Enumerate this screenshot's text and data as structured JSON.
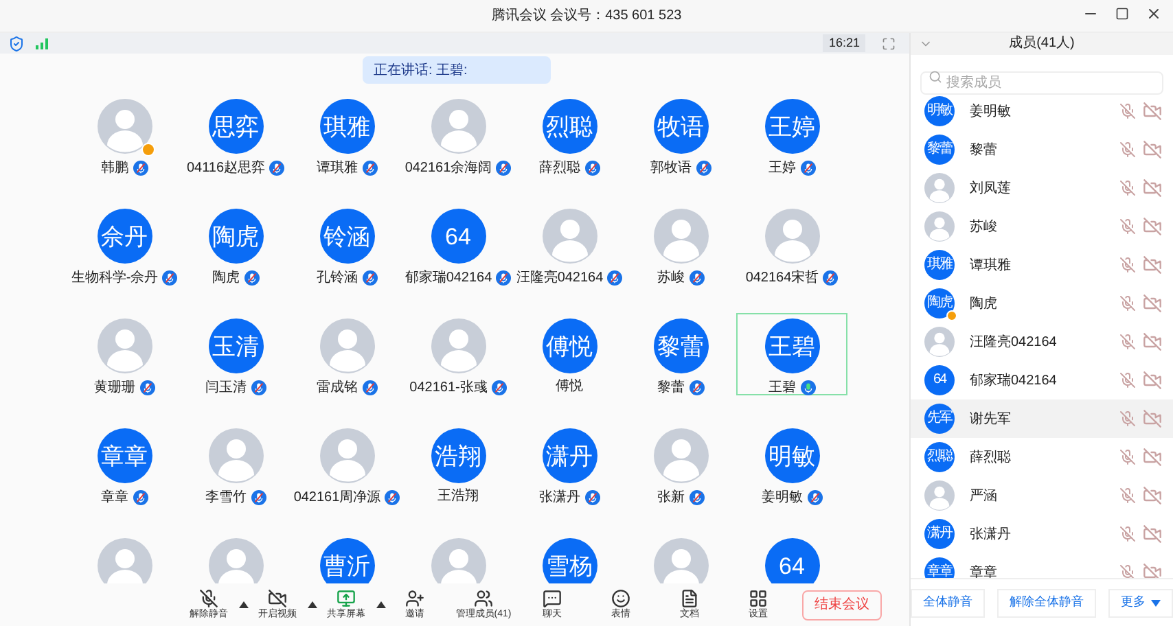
{
  "window": {
    "title": "腾讯会议 会议号：435 601 523"
  },
  "status_strip": {
    "time": "16:21"
  },
  "speaking_banner": "正在讲话: 王碧:",
  "participants": [
    {
      "name": "韩鹏",
      "kind": "photo",
      "host": true,
      "muted": true,
      "speaking": false,
      "selected": false
    },
    {
      "name": "04116赵思弈",
      "kind": "initials",
      "initials": "思弈",
      "host": false,
      "muted": true,
      "speaking": false,
      "selected": false
    },
    {
      "name": "谭琪雅",
      "kind": "initials",
      "initials": "琪雅",
      "host": false,
      "muted": true,
      "speaking": false,
      "selected": false
    },
    {
      "name": "042161余海阔",
      "kind": "photo",
      "host": false,
      "muted": true,
      "speaking": false,
      "selected": false
    },
    {
      "name": "薛烈聪",
      "kind": "initials",
      "initials": "烈聪",
      "host": false,
      "muted": true,
      "speaking": false,
      "selected": false
    },
    {
      "name": "郭牧语",
      "kind": "initials",
      "initials": "牧语",
      "host": false,
      "muted": true,
      "speaking": false,
      "selected": false
    },
    {
      "name": "王婷",
      "kind": "initials",
      "initials": "王婷",
      "host": false,
      "muted": true,
      "speaking": false,
      "selected": false
    },
    {
      "name": "生物科学-佘丹",
      "kind": "initials",
      "initials": "佘丹",
      "host": false,
      "muted": true,
      "speaking": false,
      "selected": false
    },
    {
      "name": "陶虎",
      "kind": "initials",
      "initials": "陶虎",
      "host": false,
      "muted": true,
      "speaking": false,
      "selected": false
    },
    {
      "name": "孔铃涵",
      "kind": "initials",
      "initials": "铃涵",
      "host": false,
      "muted": true,
      "speaking": false,
      "selected": false
    },
    {
      "name": "郁家瑞042164",
      "kind": "initials",
      "initials": "64",
      "host": false,
      "muted": true,
      "speaking": false,
      "selected": false
    },
    {
      "name": "汪隆亮042164",
      "kind": "photo",
      "host": false,
      "muted": true,
      "speaking": false,
      "selected": false
    },
    {
      "name": "苏峻",
      "kind": "photo",
      "host": false,
      "muted": true,
      "speaking": false,
      "selected": false
    },
    {
      "name": "042164宋哲",
      "kind": "photo",
      "host": false,
      "muted": true,
      "speaking": false,
      "selected": false
    },
    {
      "name": "黄珊珊",
      "kind": "photo",
      "host": false,
      "muted": true,
      "speaking": false,
      "selected": false
    },
    {
      "name": "闫玉清",
      "kind": "initials",
      "initials": "玉清",
      "host": false,
      "muted": true,
      "speaking": false,
      "selected": false
    },
    {
      "name": "雷成铭",
      "kind": "photo",
      "host": false,
      "muted": true,
      "speaking": false,
      "selected": false
    },
    {
      "name": "042161-张彧",
      "kind": "photo",
      "host": false,
      "muted": true,
      "speaking": false,
      "selected": false
    },
    {
      "name": "傅悦",
      "kind": "initials",
      "initials": "傅悦",
      "host": false,
      "muted": false,
      "speaking": false,
      "selected": false
    },
    {
      "name": "黎蕾",
      "kind": "initials",
      "initials": "黎蕾",
      "host": false,
      "muted": true,
      "speaking": false,
      "selected": false
    },
    {
      "name": "王碧",
      "kind": "initials",
      "initials": "王碧",
      "host": false,
      "muted": false,
      "speaking": true,
      "selected": true
    },
    {
      "name": "章章",
      "kind": "initials",
      "initials": "章章",
      "host": false,
      "muted": true,
      "speaking": false,
      "selected": false
    },
    {
      "name": "李雪竹",
      "kind": "photo",
      "host": false,
      "muted": true,
      "speaking": false,
      "selected": false
    },
    {
      "name": "042161周净源",
      "kind": "photo",
      "host": false,
      "muted": true,
      "speaking": false,
      "selected": false
    },
    {
      "name": "王浩翔",
      "kind": "initials",
      "initials": "浩翔",
      "host": false,
      "muted": false,
      "speaking": false,
      "selected": false
    },
    {
      "name": "张潇丹",
      "kind": "initials",
      "initials": "潇丹",
      "host": false,
      "muted": true,
      "speaking": false,
      "selected": false
    },
    {
      "name": "张新",
      "kind": "photo",
      "host": false,
      "muted": true,
      "speaking": false,
      "selected": false
    },
    {
      "name": "姜明敏",
      "kind": "initials",
      "initials": "明敏",
      "host": false,
      "muted": true,
      "speaking": false,
      "selected": false
    },
    {
      "kind": "photo",
      "host": false,
      "selected": false
    },
    {
      "kind": "photo",
      "host": false,
      "selected": false
    },
    {
      "kind": "initials",
      "initials": "曹沂",
      "host": false,
      "selected": false
    },
    {
      "kind": "photo",
      "host": false,
      "selected": false
    },
    {
      "kind": "initials",
      "initials": "雪杨",
      "host": false,
      "selected": false
    },
    {
      "kind": "photo",
      "host": false,
      "selected": false
    },
    {
      "kind": "initials",
      "initials": "64",
      "host": false,
      "selected": false
    }
  ],
  "toolbar": [
    {
      "kind": "mic_off",
      "label": "解除静音",
      "menu": true
    },
    {
      "kind": "video_off",
      "label": "开启视频",
      "menu": true
    },
    {
      "kind": "share",
      "label": "共享屏幕",
      "menu": true
    },
    {
      "kind": "invite",
      "label": "邀请",
      "menu": false
    },
    {
      "kind": "members",
      "label": "管理成员(41)",
      "menu": false
    },
    {
      "kind": "chat",
      "label": "聊天",
      "menu": false
    },
    {
      "kind": "emoji",
      "label": "表情",
      "menu": false
    },
    {
      "kind": "docs",
      "label": "文档",
      "menu": false
    },
    {
      "kind": "settings",
      "label": "设置",
      "menu": false
    }
  ],
  "end_button": "结束会议",
  "members_panel": {
    "title": "成员(41人)",
    "search": {
      "placeholder": "搜索成员"
    },
    "members": [
      {
        "name": "姜明敏",
        "kind": "initials",
        "initials": "明敏",
        "host": false,
        "mic_off": true,
        "video_off": true,
        "selected": false
      },
      {
        "name": "黎蕾",
        "kind": "initials",
        "initials": "黎蕾",
        "host": false,
        "mic_off": true,
        "video_off": true,
        "selected": false
      },
      {
        "name": "刘凤莲",
        "kind": "photo",
        "host": false,
        "mic_off": true,
        "video_off": true,
        "selected": false
      },
      {
        "name": "苏峻",
        "kind": "photo",
        "host": false,
        "mic_off": true,
        "video_off": true,
        "selected": false
      },
      {
        "name": "谭琪雅",
        "kind": "initials",
        "initials": "琪雅",
        "host": false,
        "mic_off": true,
        "video_off": true,
        "selected": false
      },
      {
        "name": "陶虎",
        "kind": "initials",
        "initials": "陶虎",
        "host": true,
        "mic_off": true,
        "video_off": true,
        "selected": false
      },
      {
        "name": "汪隆亮042164",
        "kind": "photo",
        "host": false,
        "mic_off": true,
        "video_off": true,
        "selected": false
      },
      {
        "name": "郁家瑞042164",
        "kind": "initials",
        "initials": "64",
        "host": false,
        "mic_off": true,
        "video_off": true,
        "selected": false
      },
      {
        "name": "谢先军",
        "kind": "initials",
        "initials": "先军",
        "host": false,
        "mic_off": true,
        "video_off": true,
        "selected": true
      },
      {
        "name": "薛烈聪",
        "kind": "initials",
        "initials": "烈聪",
        "host": false,
        "mic_off": true,
        "video_off": true,
        "selected": false
      },
      {
        "name": "严涵",
        "kind": "photo",
        "host": false,
        "mic_off": true,
        "video_off": true,
        "selected": false
      },
      {
        "name": "张潇丹",
        "kind": "initials",
        "initials": "潇丹",
        "host": false,
        "mic_off": true,
        "video_off": true,
        "selected": false
      },
      {
        "name": "章章",
        "kind": "initials",
        "initials": "章章",
        "host": false,
        "mic_off": true,
        "video_off": true,
        "selected": false
      }
    ],
    "actions": [
      {
        "label": "全体静音",
        "menu": false
      },
      {
        "label": "解除全体静音",
        "menu": false
      },
      {
        "label": "更多",
        "menu": true
      }
    ]
  }
}
